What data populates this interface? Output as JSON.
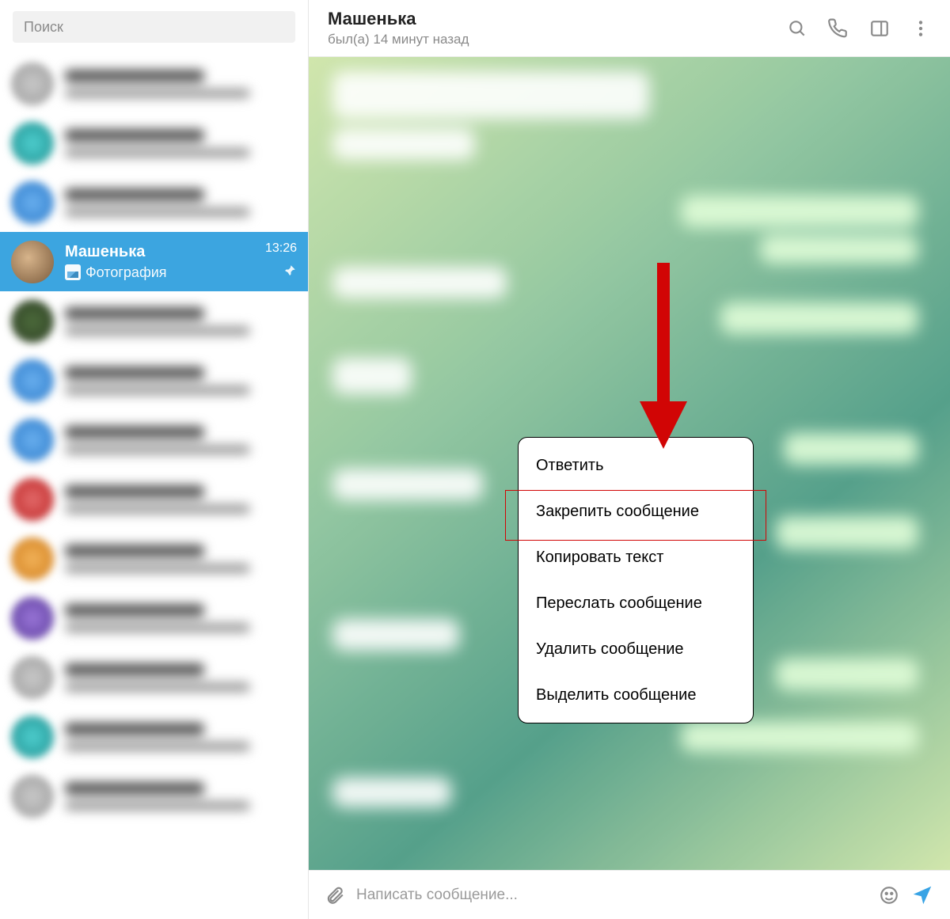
{
  "sidebar": {
    "search_placeholder": "Поиск",
    "selected_chat": {
      "name": "Машенька",
      "preview_label": "Фотография",
      "time": "13:26"
    }
  },
  "header": {
    "title": "Машенька",
    "status": "был(а) 14 минут назад"
  },
  "context_menu": {
    "items": [
      "Ответить",
      "Закрепить сообщение",
      "Копировать текст",
      "Переслать сообщение",
      "Удалить сообщение",
      "Выделить сообщение"
    ],
    "highlighted_index": 1
  },
  "composer": {
    "placeholder": "Написать сообщение..."
  }
}
